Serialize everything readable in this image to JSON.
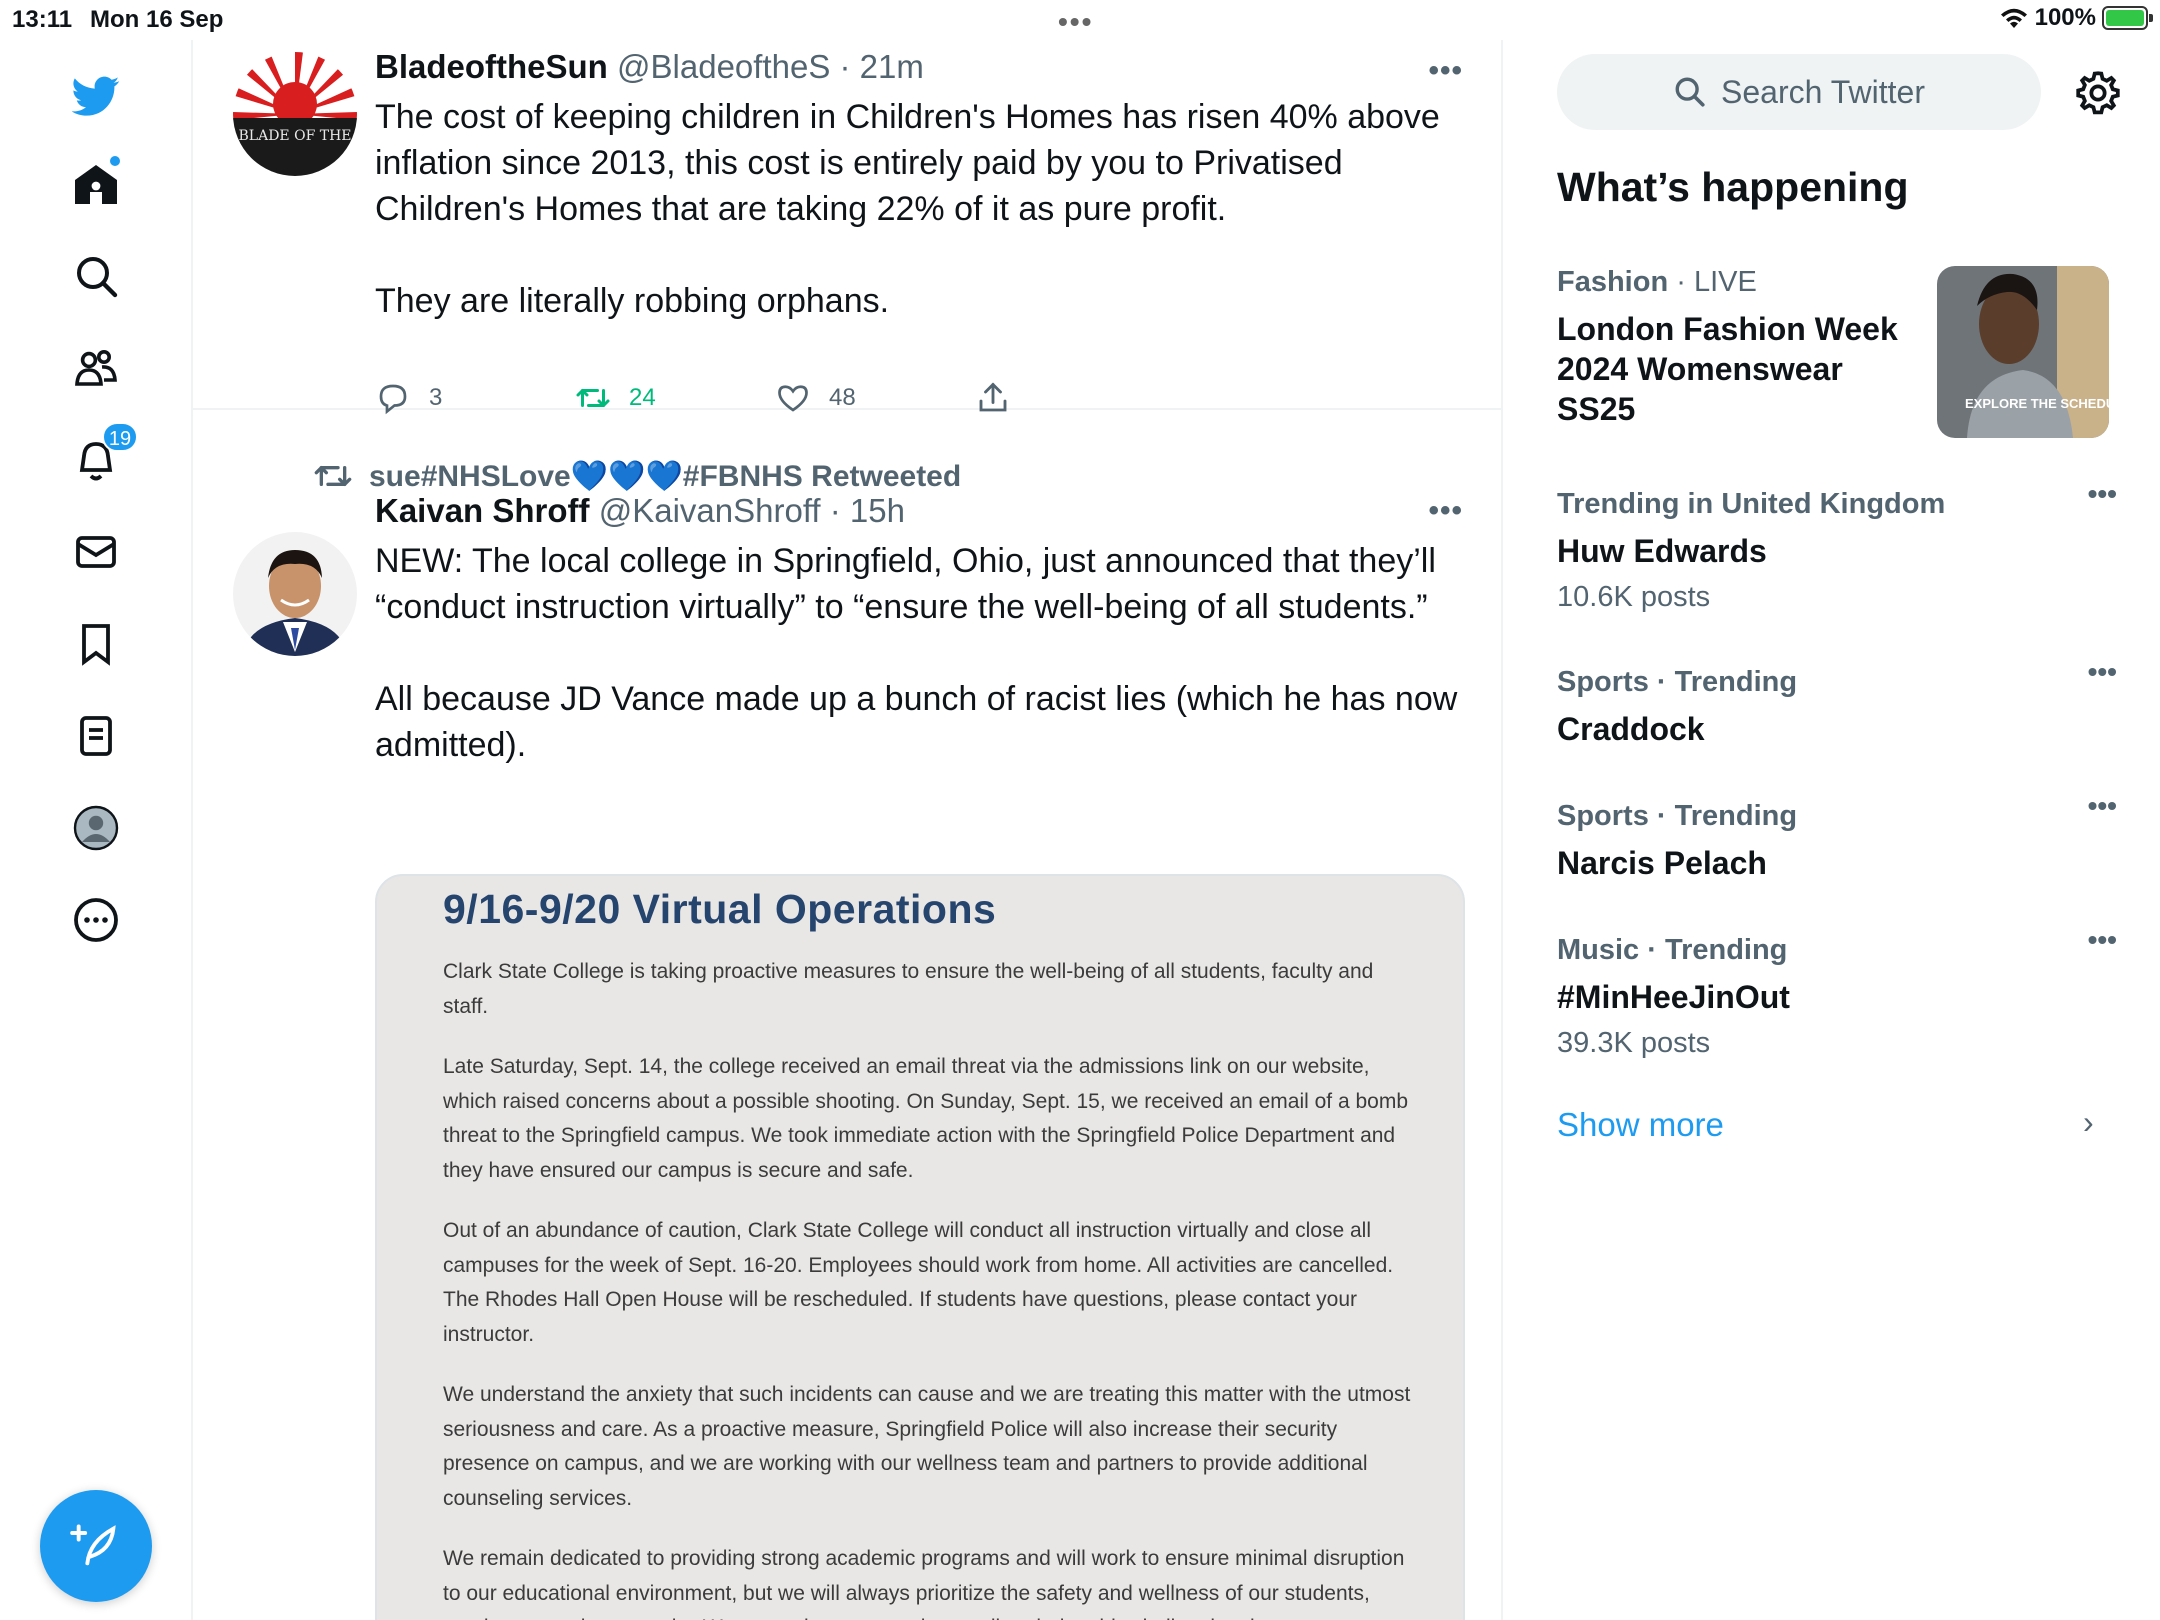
{
  "status_bar": {
    "time": "13:11",
    "date": "Mon 16 Sep",
    "battery": "100%"
  },
  "nav": {
    "notifications_badge": "19"
  },
  "tweets": [
    {
      "name": "BladeoftheSun",
      "handle": "@BladeoftheS",
      "time": "· 21m",
      "avatar_text": "BLADE OF THE",
      "text": "The cost of keeping children in Children's Homes has risen 40% above inflation since 2013, this cost is entirely paid by you to Privatised Children's Homes that are taking 22% of it as pure profit.\n\nThey are literally robbing orphans.",
      "replies": "3",
      "retweets": "24",
      "likes": "48"
    },
    {
      "retweeted_by": "sue#NHSLove💙💙💙#FBNHS Retweeted",
      "name": "Kaivan Shroff",
      "handle": "@KaivanShroff",
      "time": "· 15h",
      "text": "NEW: The local college in Springfield, Ohio, just announced that they’ll “conduct instruction virtually” to “ensure the well-being of all students.”\n\nAll because JD Vance made up a bunch of racist lies (which he has now admitted).",
      "media": {
        "title": "9/16-9/20 Virtual Operations",
        "paragraphs": [
          "Clark State College is taking proactive measures to ensure the well-being of all students, faculty and staff.",
          "Late Saturday, Sept. 14, the college received an email threat via the admissions link on our website, which raised concerns about a possible shooting. On Sunday, Sept. 15, we received an email of a bomb threat to the Springfield campus. We took immediate action with the Springfield Police Department and they have ensured our campus is secure and safe.",
          "Out of an abundance of caution, Clark State College will conduct all instruction virtually and close all campuses for the week of Sept. 16-20. Employees should work from home. All activities are cancelled. The Rhodes Hall Open House will be rescheduled.  If students have questions, please contact your instructor.",
          "We understand the anxiety that such incidents can cause and we are treating this matter with the utmost seriousness and care. As a proactive measure, Springfield Police will also increase their security presence on campus, and we are working with our wellness team and partners to provide additional counseling services.",
          "We remain dedicated to providing strong academic programs and will work to ensure minimal disruption to our educational environment, but we will always prioritize the safety and wellness of our students, employees and community. We appreciate your understanding during this challenging time."
        ]
      }
    }
  ],
  "sidebar": {
    "search_placeholder": "Search Twitter",
    "whats_happening": "What’s happening",
    "trends": [
      {
        "category": "Fashion",
        "live": " · LIVE",
        "title": "London Fashion Week 2024 Womenswear SS25",
        "count": "",
        "image_caption": "EXPLORE THE SCHEDUL"
      },
      {
        "category": "Trending in United Kingdom",
        "live": "",
        "title": "Huw Edwards",
        "count": "10.6K posts"
      },
      {
        "category": "Sports · Trending",
        "live": "",
        "title": "Craddock",
        "count": ""
      },
      {
        "category": "Sports · Trending",
        "live": "",
        "title": "Narcis Pelach",
        "count": ""
      },
      {
        "category": "Music · Trending",
        "live": "",
        "title": "#MinHeeJinOut",
        "count": "39.3K posts"
      }
    ],
    "show_more": "Show more"
  },
  "colors": {
    "accent": "#1d9bf0",
    "retweet_green": "#00ba7c",
    "secondary_text": "#536471",
    "doc_title": "#26456e"
  }
}
